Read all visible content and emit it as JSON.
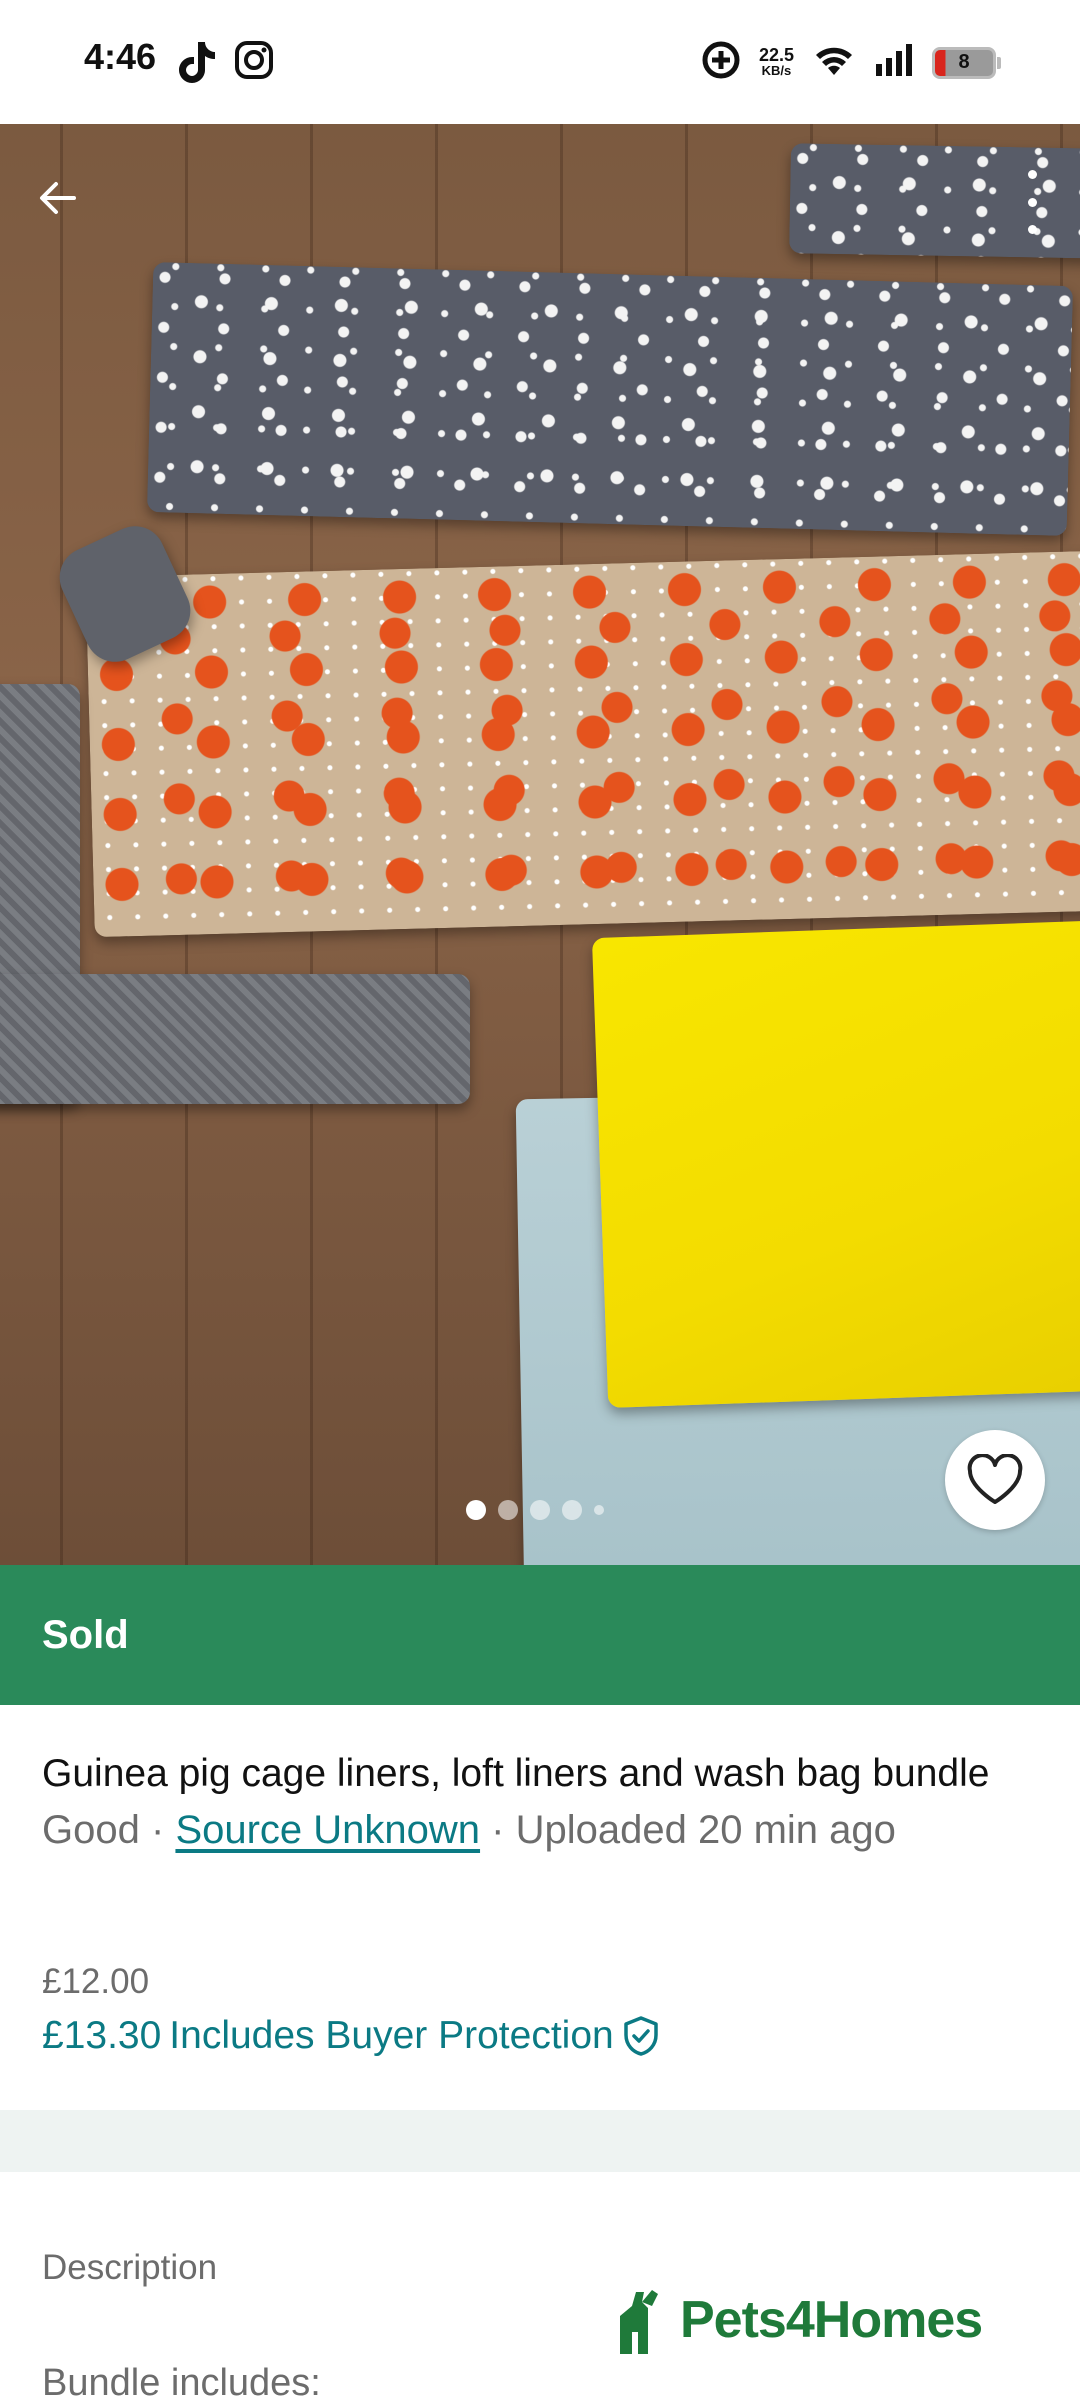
{
  "status_bar": {
    "time": "4:46",
    "net_speed_value": "22.5",
    "net_speed_unit": "KB/s",
    "battery_level": "8"
  },
  "listing": {
    "status_banner": "Sold",
    "title": "Guinea pig cage liners, loft liners and wash bag bundle",
    "condition": "Good",
    "separator": "·",
    "source_link": "Source Unknown",
    "uploaded": "Uploaded 20 min ago",
    "price_original": "£12.00",
    "price_total": "£13.30",
    "buyer_protection": "Includes Buyer Protection",
    "description_label": "Description",
    "description_preview": "Bundle includes:"
  },
  "carousel": {
    "total_dots": 5,
    "active_index": 0
  },
  "watermark": {
    "text": "Pets4Homes"
  },
  "icons": {
    "back": "arrow-left-icon",
    "more": "more-vertical-icon",
    "favorite": "heart-icon",
    "protection": "shield-check-icon"
  },
  "colors": {
    "sold_banner": "#2a8a5a",
    "accent_teal": "#0b7a84",
    "band": "#eef3f2",
    "watermark": "#1f7a3a"
  }
}
